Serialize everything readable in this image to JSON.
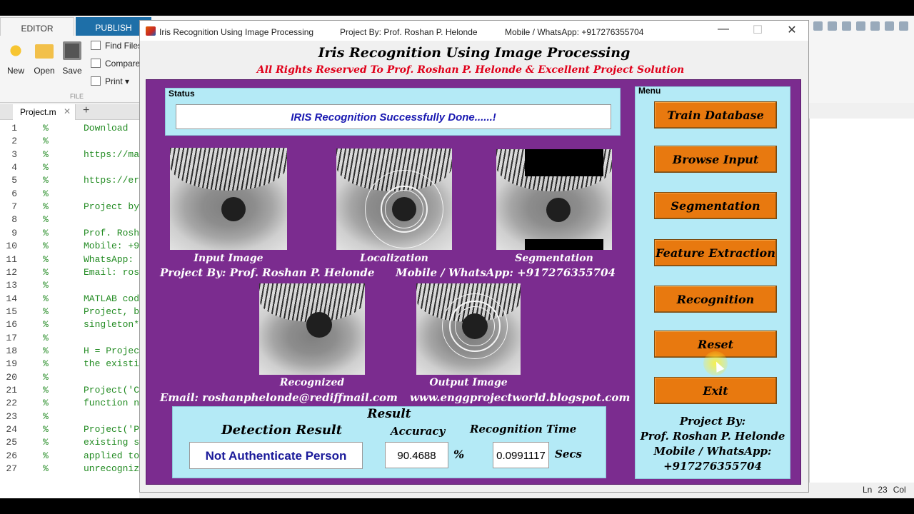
{
  "toolstrip": {
    "tabs": [
      "EDITOR",
      "PUBLISH"
    ],
    "buttons": [
      "New",
      "Open",
      "Save"
    ],
    "small_buttons": [
      "Find Files",
      "Compare",
      "Print"
    ],
    "section_label": "FILE"
  },
  "file_tab": {
    "name": "Project.m",
    "close": "✕",
    "add": "+"
  },
  "editor": {
    "line_numbers": [
      "1",
      "2",
      "3",
      "4",
      "5",
      "6",
      "7",
      "8",
      "9",
      "10",
      "11",
      "12",
      "13",
      "14",
      "15",
      "16",
      "17",
      "18",
      "19",
      "20",
      "21",
      "22",
      "23",
      "24",
      "25",
      "26",
      "27"
    ],
    "comment_marker": "%",
    "lines": [
      "Download ",
      "",
      "https://ma",
      "",
      "https://er",
      "",
      "Project by",
      "",
      "Prof. Rosh",
      "Mobile: +9",
      "WhatsApp: ",
      "Email: ros",
      "",
      "MATLAB cod",
      "Project, b",
      "singleton*",
      "",
      "H = Projec",
      "the existi",
      "",
      "Project('C",
      "function n",
      "",
      "Project('P",
      "existing s",
      "applied to",
      "unrecogniz"
    ]
  },
  "statusbar": {
    "ln_label": "Ln",
    "ln_value": "23",
    "col_label": "Col"
  },
  "window": {
    "title": "Iris Recognition Using Image Processing",
    "title_project": "Project By: Prof. Roshan P. Helonde",
    "title_contact": "Mobile / WhatsApp: +917276355704",
    "controls": {
      "minimize": "—",
      "maximize": "☐",
      "close": "✕"
    }
  },
  "app": {
    "heading": "Iris Recognition Using Image Processing",
    "subheading": "All Rights Reserved To Prof. Roshan P. Helonde & Excellent Project Solution"
  },
  "status_panel": {
    "label": "Status",
    "message": "IRIS Recognition Successfully Done......!"
  },
  "images": {
    "input": "Input Image",
    "localization": "Localization",
    "segmentation": "Segmentation",
    "recognized": "Recognized",
    "output": "Output Image"
  },
  "info": {
    "project_by": "Project By: Prof. Roshan P. Helonde",
    "mobile": "Mobile / WhatsApp: +917276355704",
    "email": "Email: roshanphelonde@rediffmail.com",
    "website": "www.enggprojectworld.blogspot.com"
  },
  "result": {
    "title": "Result",
    "detection_label": "Detection Result",
    "detection_value": "Not Authenticate Person",
    "accuracy_label": "Accuracy",
    "accuracy_value": "90.4688",
    "accuracy_unit": "%",
    "time_label": "Recognition Time",
    "time_value": "0.0991117",
    "time_unit": "Secs"
  },
  "menu": {
    "label": "Menu",
    "buttons": [
      "Train Database",
      "Browse Input",
      "Segmentation",
      "Feature Extraction",
      "Recognition",
      "Reset",
      "Exit"
    ],
    "footer": [
      "Project By:",
      "Prof. Roshan P. Helonde",
      "Mobile / WhatsApp:",
      "+917276355704"
    ]
  },
  "colors": {
    "panel_bg": "#7b2c8f",
    "sub_panel": "#b4eaf6",
    "button": "#e8790f",
    "status_text": "#1a1ab2",
    "subtitle": "#e0001a"
  }
}
